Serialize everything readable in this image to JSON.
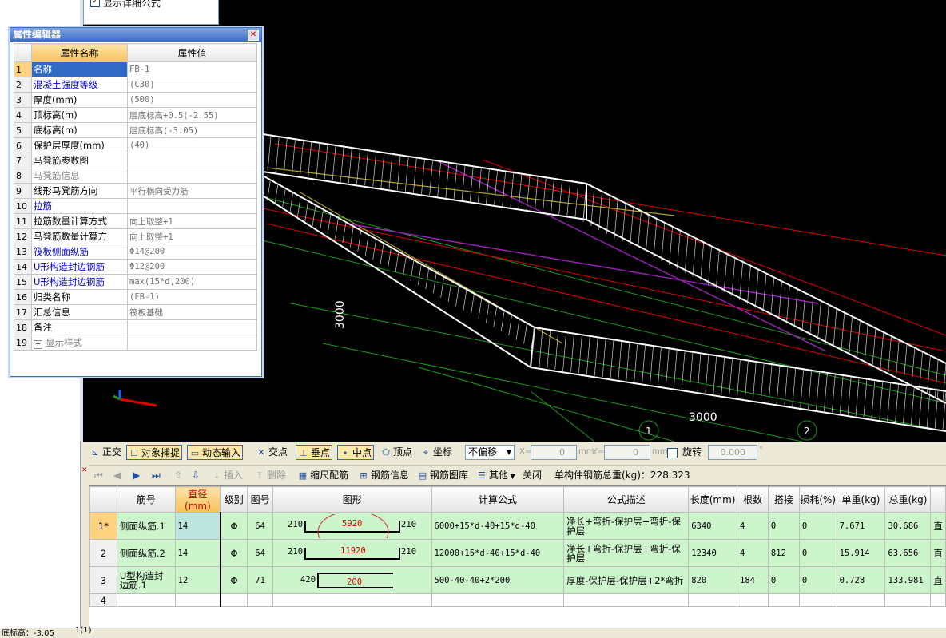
{
  "top_panel": {
    "checkbox_label": "显示详细公式"
  },
  "property_editor": {
    "title": "属性编辑器",
    "col_name": "属性名称",
    "col_value": "属性值",
    "rows": [
      {
        "num": "1",
        "name": "名称",
        "value": "FB-1"
      },
      {
        "num": "2",
        "name": "混凝土强度等级",
        "value": "(C30)"
      },
      {
        "num": "3",
        "name": "厚度(mm)",
        "value": "(500)"
      },
      {
        "num": "4",
        "name": "顶标高(m)",
        "value": "层底标高+0.5(-2.55)"
      },
      {
        "num": "5",
        "name": "底标高(m)",
        "value": "层底标高(-3.05)"
      },
      {
        "num": "6",
        "name": "保护层厚度(mm)",
        "value": "(40)"
      },
      {
        "num": "7",
        "name": "马凳筋参数图",
        "value": ""
      },
      {
        "num": "8",
        "name": "马凳筋信息",
        "value": ""
      },
      {
        "num": "9",
        "name": "线形马凳筋方向",
        "value": "平行横向受力筋"
      },
      {
        "num": "10",
        "name": "拉筋",
        "value": ""
      },
      {
        "num": "11",
        "name": "拉筋数量计算方式",
        "value": "向上取整+1"
      },
      {
        "num": "12",
        "name": "马凳筋数量计算方",
        "value": "向上取整+1"
      },
      {
        "num": "13",
        "name": "筏板侧面纵筋",
        "value": "Φ14@200"
      },
      {
        "num": "14",
        "name": "U形构造封边钢筋",
        "value": "Φ12@200"
      },
      {
        "num": "15",
        "name": "U形构造封边钢筋",
        "value": "max(15*d,200)"
      },
      {
        "num": "16",
        "name": "归类名称",
        "value": "(FB-1)"
      },
      {
        "num": "17",
        "name": "汇总信息",
        "value": "筏板基础"
      },
      {
        "num": "18",
        "name": "备注",
        "value": ""
      },
      {
        "num": "19",
        "name": "显示样式",
        "value": ""
      }
    ]
  },
  "viewport": {
    "dim_vertical": "3000",
    "dim_horizontal": "3000",
    "axis_1": "1",
    "axis_2": "2"
  },
  "toolbar1": {
    "ortho": "正交",
    "snap": "对象捕捉",
    "dyn_input": "动态输入",
    "intersection": "交点",
    "perpendicular": "垂点",
    "midpoint": "中点",
    "vertex": "顶点",
    "coordinate": "坐标",
    "offset_mode": "不偏移",
    "x_label": "X=",
    "x_value": "0",
    "y_label": "Y=",
    "y_value": "0",
    "unit": "mm",
    "rotate": "旋转",
    "rotate_value": "0.000",
    "degree": "°"
  },
  "toolbar2": {
    "insert": "插入",
    "delete": "删除",
    "scale_rebar": "缩尺配筋",
    "rebar_info": "钢筋信息",
    "rebar_library": "钢筋图库",
    "other": "其他",
    "close": "关闭",
    "total_weight": "单构件钢筋总重(kg)：228.323"
  },
  "rebar_table": {
    "headers": [
      "筋号",
      "直径(mm)",
      "级别",
      "图号",
      "图形",
      "计算公式",
      "公式描述",
      "长度(mm)",
      "根数",
      "搭接",
      "损耗(%)",
      "单重(kg)",
      "总重(kg)"
    ],
    "rows": [
      {
        "num": "1*",
        "name": "侧面纵筋.1",
        "dia": "14",
        "grade": "Φ",
        "fig": "64",
        "left": "210",
        "mid": "5920",
        "right": "210",
        "formula": "6000+15*d-40+15*d-40",
        "desc": "净长+弯折-保护层+弯折-保护层",
        "length": "6340",
        "count": "4",
        "lap": "0",
        "loss": "0",
        "unit_w": "7.671",
        "total_w": "30.686"
      },
      {
        "num": "2",
        "name": "侧面纵筋.2",
        "dia": "14",
        "grade": "Φ",
        "fig": "64",
        "left": "210",
        "mid": "11920",
        "right": "210",
        "formula": "12000+15*d-40+15*d-40",
        "desc": "净长+弯折-保护层+弯折-保护层",
        "length": "12340",
        "count": "4",
        "lap": "812",
        "loss": "0",
        "unit_w": "15.914",
        "total_w": "63.656"
      },
      {
        "num": "3",
        "name": "U型构造封边筋.1",
        "dia": "12",
        "grade": "Φ",
        "fig": "71",
        "left": "420",
        "mid": "200",
        "right": "",
        "formula": "500-40-40+2*200",
        "desc": "厚度-保护层-保护层+2*弯折",
        "length": "820",
        "count": "184",
        "lap": "0",
        "loss": "0",
        "unit_w": "0.728",
        "total_w": "133.981"
      },
      {
        "num": "4",
        "name": "",
        "dia": "",
        "grade": "",
        "fig": "",
        "left": "",
        "mid": "",
        "right": "",
        "formula": "",
        "desc": "",
        "length": "",
        "count": "",
        "lap": "",
        "loss": "",
        "unit_w": "",
        "total_w": ""
      }
    ],
    "last_col_1": "直",
    "last_col_2": "直",
    "last_col_3": "直"
  },
  "status_bar": {
    "left": "底标高：-3.05",
    "mid": "1(1)"
  },
  "colors": {
    "selection": "#316ac5",
    "header_sel": "#f7c25b",
    "row_bg": "#ccf5cc",
    "shape_red": "#e00000"
  }
}
